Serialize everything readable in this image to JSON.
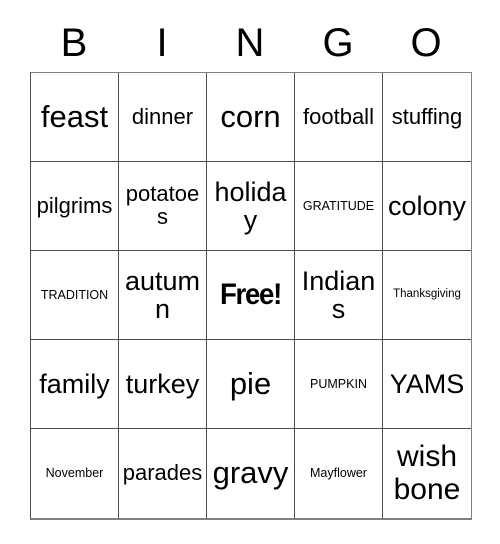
{
  "card": {
    "type": "bingo-card",
    "theme": "Thanksgiving",
    "header_letters": [
      "B",
      "I",
      "N",
      "G",
      "O"
    ],
    "columns": 5,
    "rows": 5,
    "free_space": {
      "row": 3,
      "column": 3,
      "label": "Free!"
    },
    "colors": {
      "background": "#ffffff",
      "text": "#000000",
      "grid_line": "#4d4d4d",
      "outer_border": "#808080"
    },
    "cells": [
      [
        {
          "text": "feast",
          "size": "fs-xl"
        },
        {
          "text": "dinner",
          "size": "fs-md"
        },
        {
          "text": "corn",
          "size": "fs-xl"
        },
        {
          "text": "football",
          "size": "fs-md"
        },
        {
          "text": "stuffing",
          "size": "fs-md"
        }
      ],
      [
        {
          "text": "pilgrims",
          "size": "fs-md"
        },
        {
          "text": "potatoes",
          "size": "fs-md"
        },
        {
          "text": "holiday",
          "size": "fs-lg"
        },
        {
          "text": "GRATITUDE",
          "size": "fs-xs"
        },
        {
          "text": "colony",
          "size": "fs-lg"
        }
      ],
      [
        {
          "text": "TRADITION",
          "size": "fs-xs"
        },
        {
          "text": "autumn",
          "size": "fs-lg"
        },
        {
          "text": "Free!",
          "size": "free"
        },
        {
          "text": "Indians",
          "size": "fs-lg"
        },
        {
          "text": "Thanksgiving",
          "size": "fs-xxs"
        }
      ],
      [
        {
          "text": "family",
          "size": "fs-lg"
        },
        {
          "text": "turkey",
          "size": "fs-lg"
        },
        {
          "text": "pie",
          "size": "fs-xl"
        },
        {
          "text": "PUMPKIN",
          "size": "fs-xs"
        },
        {
          "text": "YAMS",
          "size": "fs-lg"
        }
      ],
      [
        {
          "text": "November",
          "size": "fs-xs"
        },
        {
          "text": "parades",
          "size": "fs-md"
        },
        {
          "text": "gravy",
          "size": "fs-xl"
        },
        {
          "text": "Mayflower",
          "size": "fs-xs"
        },
        {
          "text": "wish bone",
          "size": "two-line"
        }
      ]
    ]
  }
}
